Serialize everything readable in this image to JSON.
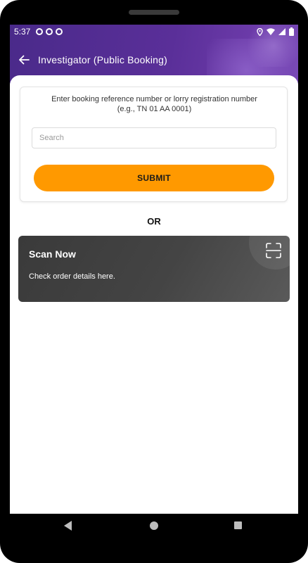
{
  "status_bar": {
    "time": "5:37"
  },
  "app_bar": {
    "title": "Investigator (Public Booking)",
    "back_icon": "arrow-left-icon"
  },
  "search_card": {
    "instruction_line1": "Enter booking reference number or lorry registration number",
    "instruction_line2": "(e.g., TN 01 AA 0001)",
    "search_placeholder": "Search",
    "search_value": "",
    "submit_label": "SUBMIT"
  },
  "divider_text": "OR",
  "scan_card": {
    "title": "Scan Now",
    "subtitle": "Check order details here.",
    "icon": "scan-frame-icon"
  },
  "colors": {
    "header": "#5a2f99",
    "accent": "#FF9900",
    "scan_card": "#444444"
  }
}
